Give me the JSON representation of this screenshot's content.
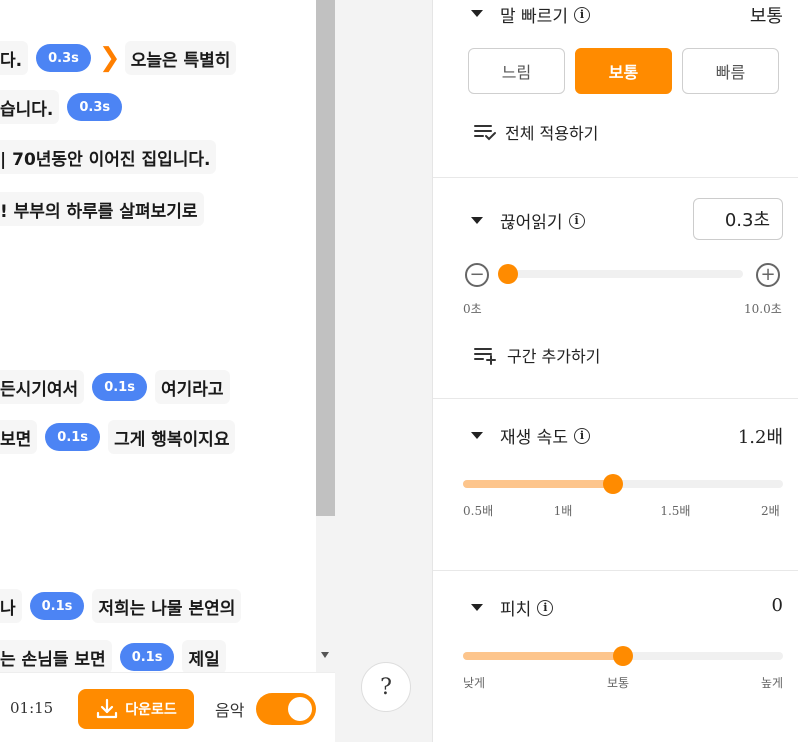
{
  "script_lines": [
    {
      "parts": [
        {
          "type": "text",
          "text": "다.",
          "cut": true
        },
        {
          "type": "pause",
          "text": "0.3s"
        },
        {
          "type": "arrow",
          "text": "❯"
        },
        {
          "type": "text",
          "text": "오늘은 특별히"
        }
      ]
    },
    {
      "parts": [
        {
          "type": "text",
          "text": "습니다.",
          "cut": true
        },
        {
          "type": "pause",
          "text": "0.3s"
        }
      ]
    },
    {
      "parts": [
        {
          "type": "text",
          "text": "| 70년동안 이어진 집입니다.",
          "cut": true
        }
      ]
    },
    {
      "parts": [
        {
          "type": "text",
          "text": "! 부부의 하루를 살펴보기로",
          "cut": true
        }
      ]
    },
    {
      "parts": [
        {
          "type": "text",
          "text": "든시기여서",
          "cut": true
        },
        {
          "type": "pause",
          "text": "0.1s"
        },
        {
          "type": "text",
          "text": "여기라고"
        }
      ]
    },
    {
      "parts": [
        {
          "type": "text",
          "text": "보면",
          "cut": true
        },
        {
          "type": "pause",
          "text": "0.1s"
        },
        {
          "type": "text",
          "text": "그게 행복이지요"
        }
      ]
    },
    {
      "parts": [
        {
          "type": "text",
          "text": "나",
          "cut": true
        },
        {
          "type": "pause",
          "text": "0.1s"
        },
        {
          "type": "text",
          "text": "저희는 나물 본연의"
        }
      ]
    },
    {
      "parts": [
        {
          "type": "text",
          "text": "는 손님들 보면",
          "cut": true
        },
        {
          "type": "pause",
          "text": "0.1s"
        },
        {
          "type": "text",
          "text": "제일"
        }
      ]
    }
  ],
  "bottom": {
    "time": "01:15",
    "download_label": "다운로드",
    "music_label": "음악",
    "music_on": true,
    "help_label": "?"
  },
  "panel": {
    "speed": {
      "title": "말 빠르기",
      "value": "보통",
      "options": [
        "느림",
        "보통",
        "빠름"
      ],
      "active_index": 1,
      "apply_all": "전체 적용하기"
    },
    "pause": {
      "title": "끊어읽기",
      "value": "0.3초",
      "min_label": "0초",
      "max_label": "10.0초",
      "level": 0.03,
      "add_section": "구간 추가하기"
    },
    "playback": {
      "title": "재생 속도",
      "value": "1.2배",
      "ticks": [
        "0.5배",
        "1배",
        "1.5배",
        "2배"
      ],
      "level": 0.47
    },
    "pitch": {
      "title": "피치",
      "value": "0",
      "ticks": [
        "낮게",
        "보통",
        "높게"
      ],
      "level": 0.5
    }
  },
  "colors": {
    "accent": "#ff8b00",
    "pause_badge": "#4c84f4",
    "slider_fill": "#fdc58c"
  }
}
